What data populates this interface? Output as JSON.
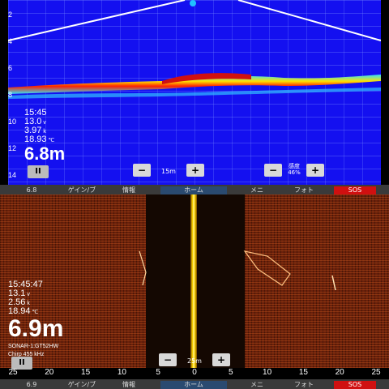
{
  "top": {
    "depth_scale": [
      "2",
      "4",
      "6",
      "8",
      "10",
      "12",
      "14"
    ],
    "readouts": {
      "time": "15:45",
      "voltage": "13.0",
      "voltage_unit": "v",
      "speed": "3.97",
      "speed_unit": "k",
      "temperature": "18.93",
      "temperature_unit": "℃",
      "depth": "6.8m"
    },
    "pause_label": "II",
    "zoom": {
      "minus": "−",
      "value": "15m",
      "plus": "+"
    },
    "gain": {
      "minus": "−",
      "label": "感度",
      "value": "46%",
      "plus": "+"
    },
    "softbar": [
      "6.8",
      "ゲイン/ブ",
      "情報",
      "ホーム",
      "メニ",
      "フォト",
      "SOS"
    ]
  },
  "bottom": {
    "readouts": {
      "time": "15:45:47",
      "voltage": "13.1",
      "voltage_unit": "v",
      "speed": "2.56",
      "speed_unit": "k",
      "temperature": "18.94",
      "temperature_unit": "℃",
      "depth": "6.9m",
      "transducer": "SONAR-1:GT52HW",
      "frequency": "Chirp 455 kHz"
    },
    "pause_label": "II",
    "zoom": {
      "minus": "−",
      "value": "25m",
      "plus": "+"
    },
    "range_scale": [
      "25",
      "20",
      "15",
      "10",
      "5",
      "0",
      "5",
      "10",
      "15",
      "20",
      "25"
    ],
    "softbar": [
      "6.9",
      "ゲイン/ブ",
      "情報",
      "ホーム",
      "メニ",
      "フォト",
      "SOS"
    ]
  },
  "colors": {
    "sonar_background": "#1410f0",
    "sidescan_bottom": "#6a200a",
    "center_line": "#ffd800",
    "sos": "#d01010"
  }
}
